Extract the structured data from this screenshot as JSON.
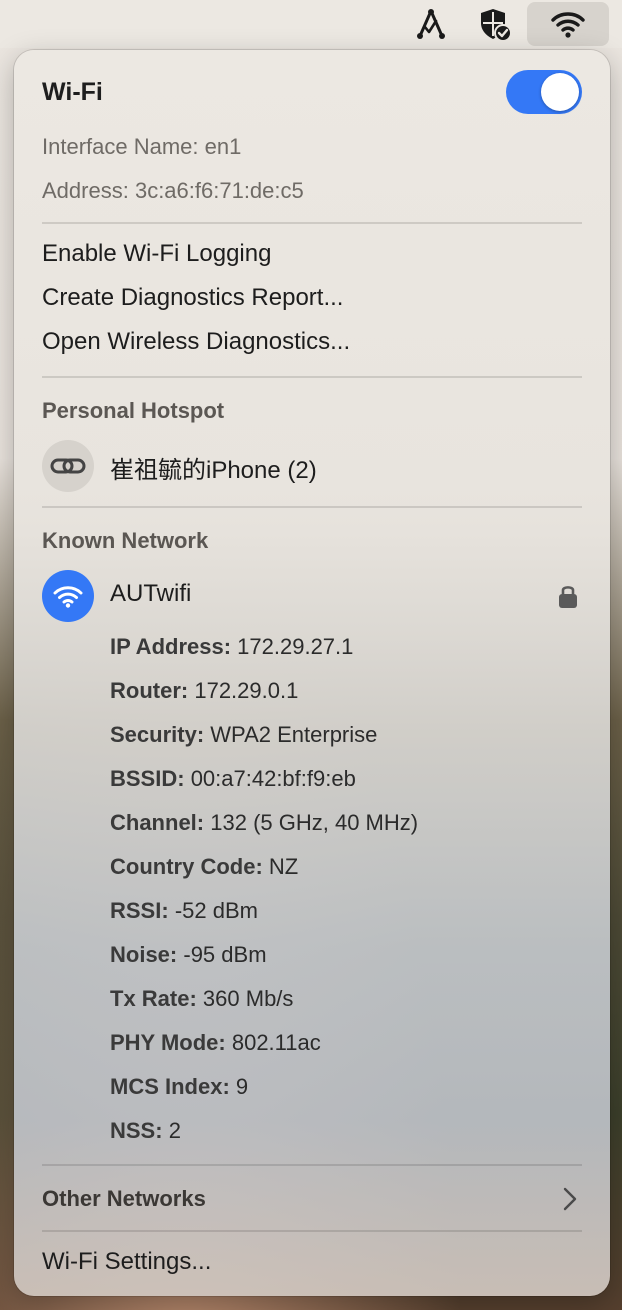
{
  "menubar": {
    "icons": [
      "network-share-icon",
      "vpn-shield-check-icon",
      "wifi-icon"
    ]
  },
  "header": {
    "title": "Wi-Fi",
    "toggle_on": true,
    "interface_label": "Interface Name:",
    "interface_value": "en1",
    "address_label": "Address:",
    "address_value": "3c:a6:f6:71:de:c5"
  },
  "actions": {
    "logging": "Enable Wi-Fi Logging",
    "diagnostics_report": "Create Diagnostics Report...",
    "wireless_diagnostics": "Open Wireless Diagnostics..."
  },
  "hotspot": {
    "section_title": "Personal Hotspot",
    "device_name": "崔祖毓的iPhone (2)",
    "icon": "link-icon"
  },
  "known": {
    "section_title": "Known Network",
    "network_name": "AUTwifi",
    "icons": [
      "wifi-icon",
      "lock-icon"
    ],
    "details": [
      {
        "k": "IP Address:",
        "v": "172.29.27.1"
      },
      {
        "k": "Router:",
        "v": "172.29.0.1"
      },
      {
        "k": "Security:",
        "v": "WPA2 Enterprise"
      },
      {
        "k": "BSSID:",
        "v": "00:a7:42:bf:f9:eb"
      },
      {
        "k": "Channel:",
        "v": "132 (5 GHz, 40 MHz)"
      },
      {
        "k": "Country Code:",
        "v": "NZ"
      },
      {
        "k": "RSSI:",
        "v": "-52 dBm"
      },
      {
        "k": "Noise:",
        "v": "-95 dBm"
      },
      {
        "k": "Tx Rate:",
        "v": "360 Mb/s"
      },
      {
        "k": "PHY Mode:",
        "v": "802.11ac"
      },
      {
        "k": "MCS Index:",
        "v": "9"
      },
      {
        "k": "NSS:",
        "v": "2"
      }
    ]
  },
  "other": {
    "label": "Other Networks",
    "icon": "chevron-right-icon"
  },
  "settings": {
    "label": "Wi-Fi Settings..."
  },
  "colors": {
    "accent": "#3478f6",
    "text": "#1d1d1d",
    "muted": "#6f6b66"
  }
}
